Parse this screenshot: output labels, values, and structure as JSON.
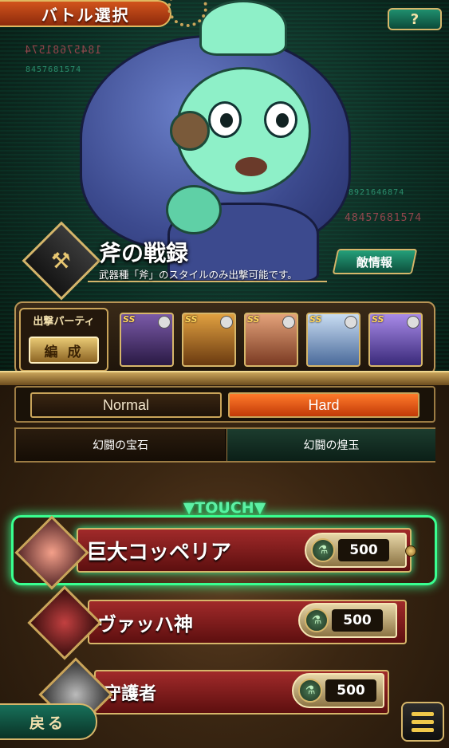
{
  "header": {
    "title": "バトル選択",
    "help_label": "?"
  },
  "background_codes": [
    "18457681574",
    "8457681574",
    "78921646874",
    "48457681574"
  ],
  "stage": {
    "icon": "axe-icon",
    "title": "斧の戦録",
    "description": "武器種「斧」のスタイルのみ出撃可能です。",
    "enemy_info_label": "敵情報"
  },
  "party": {
    "label": "出撃パーティ",
    "formation_label": "編 成",
    "members": [
      {
        "rank": "SS",
        "color": "#5a3a8a"
      },
      {
        "rank": "SS",
        "color": "#b86a22"
      },
      {
        "rank": "SS",
        "color": "#c47a55"
      },
      {
        "rank": "SS",
        "color": "#8aa8d0"
      },
      {
        "rank": "SS",
        "color": "#7a5fc0"
      }
    ]
  },
  "difficulty": {
    "normal_label": "Normal",
    "hard_label": "Hard",
    "selected": "Hard"
  },
  "rewards": {
    "left_label": "幻闘の宝石",
    "right_label": "幻闘の煌玉"
  },
  "touch_label": "▼TOUCH▼",
  "battles": [
    {
      "name": "巨大コッペリア",
      "cost": "500",
      "selected": true
    },
    {
      "name": "ヴァッハ神",
      "cost": "500",
      "selected": false
    },
    {
      "name": "守護者",
      "cost": "500",
      "selected": false
    }
  ],
  "footer": {
    "back_label": "戻る"
  },
  "colors": {
    "accent_gold": "#d6b66a",
    "touch_green": "#39ff90",
    "hard_orange": "#ff7a2a"
  }
}
